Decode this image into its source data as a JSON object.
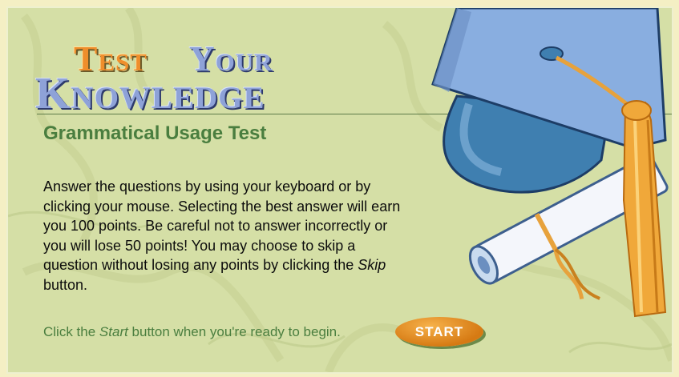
{
  "title": {
    "word1": "Test",
    "word2": "Your",
    "word3": "Knowledge"
  },
  "subtitle": "Grammatical Usage Test",
  "instructions": {
    "part1": "Answer the questions by using your keyboard or by clicking your mouse. Selecting the best answer will earn you 100 points. Be careful not to answer incorrectly or you will lose 50 points! You may choose to skip a question without losing any points by clicking the ",
    "skip_word": "Skip",
    "part2": " button."
  },
  "ready": {
    "before": "Click the ",
    "start_word": "Start",
    "after": " button when you're ready to begin."
  },
  "start_button": "START",
  "colors": {
    "background": "#d5dfa6",
    "title_orange": "#ef8e2c",
    "title_blue": "#8ea2d8",
    "subtitle_green": "#4a7e3f",
    "button_orange": "#e28b22"
  }
}
